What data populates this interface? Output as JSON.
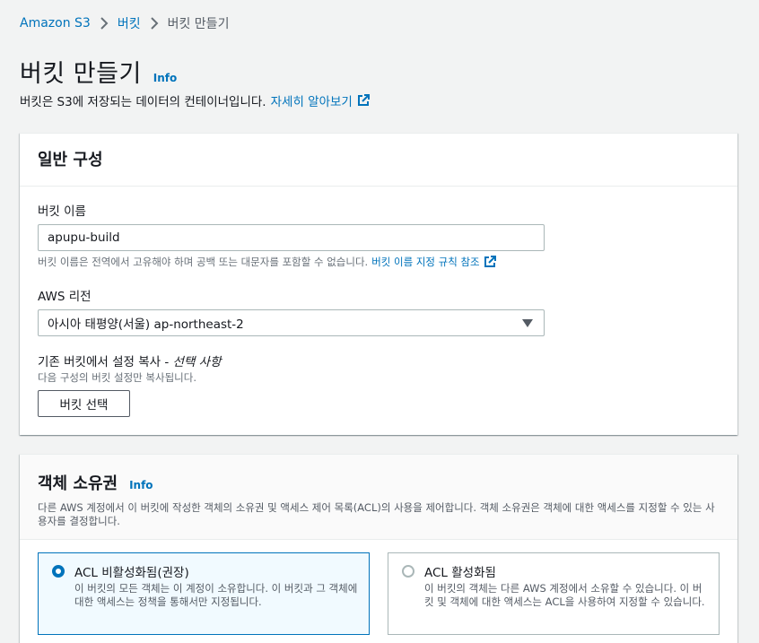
{
  "breadcrumb": {
    "items": [
      "Amazon S3",
      "버킷",
      "버킷 만들기"
    ]
  },
  "header": {
    "title": "버킷 만들기",
    "info": "Info",
    "description": "버킷은 S3에 저장되는 데이터의 컨테이너입니다.",
    "learn_more": "자세히 알아보기"
  },
  "general": {
    "title": "일반 구성",
    "bucket_name_label": "버킷 이름",
    "bucket_name_value": "apupu-build",
    "bucket_name_hint": "버킷 이름은 전역에서 고유해야 하며 공백 또는 대문자를 포함할 수 없습니다.",
    "bucket_name_rules_link": "버킷 이름 지정 규칙 참조",
    "region_label": "AWS 리전",
    "region_value": "아시아 태평양(서울) ap-northeast-2",
    "copy_label": "기존 버킷에서 설정 복사 -",
    "copy_optional": "선택 사항",
    "copy_hint": "다음 구성의 버킷 설정만 복사됩니다.",
    "choose_bucket_button": "버킷 선택"
  },
  "ownership": {
    "title": "객체 소유권",
    "info": "Info",
    "description": "다른 AWS 계정에서 이 버킷에 작성한 객체의 소유권 및 액세스 제어 목록(ACL)의 사용을 제어합니다. 객체 소유권은 객체에 대한 액세스를 지정할 수 있는 사용자를 결정합니다.",
    "options": [
      {
        "title": "ACL 비활성화됨(권장)",
        "description": "이 버킷의 모든 객체는 이 계정이 소유합니다. 이 버킷과 그 객체에 대한 액세스는 정책을 통해서만 지정됩니다.",
        "selected": true
      },
      {
        "title": "ACL 활성화됨",
        "description": "이 버킷의 객체는 다른 AWS 계정에서 소유할 수 있습니다. 이 버킷 및 객체에 대한 액세스는 ACL을 사용하여 지정할 수 있습니다.",
        "selected": false
      }
    ]
  },
  "colors": {
    "link": "#0073bb",
    "background": "#f2f3f3",
    "selected_card_bg": "#f1faff"
  }
}
